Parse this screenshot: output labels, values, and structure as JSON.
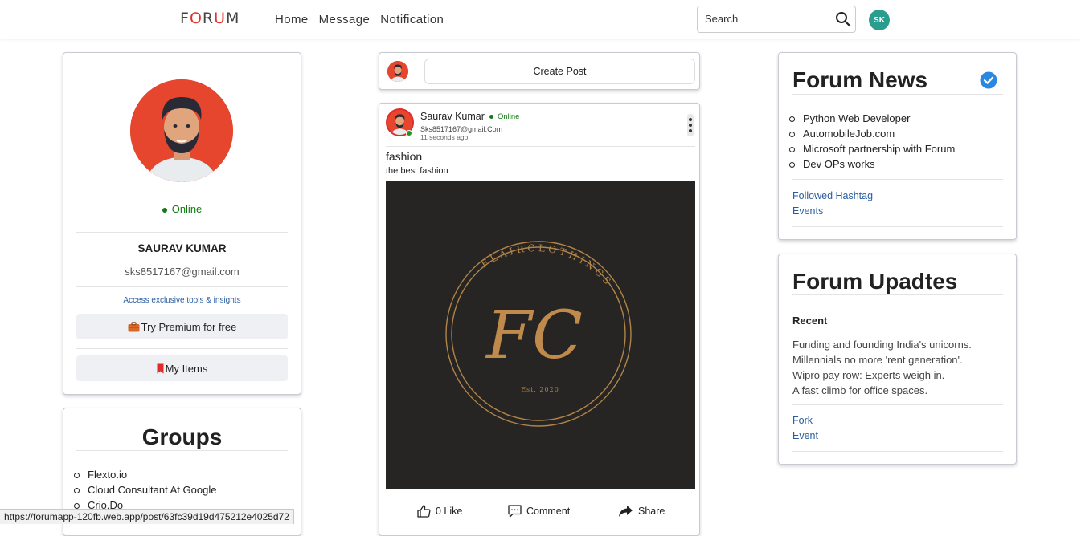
{
  "header": {
    "logo_f": "F",
    "logo_o": "O",
    "logo_r": "R",
    "logo_u": "U",
    "logo_m": "M",
    "nav": [
      "Home",
      "Message",
      "Notification"
    ],
    "search_placeholder": "Search",
    "user_initials": "SK",
    "search_icon": "search-icon",
    "accent_color": "#2a9d8f"
  },
  "profile": {
    "status": "Online",
    "name": "SAURAV KUMAR",
    "email": "sks8517167@gmail.com",
    "access_text": "Access exclusive tools & insights",
    "premium_label": "Try Premium for free",
    "my_items_label": "My Items"
  },
  "groups": {
    "title": "Groups",
    "items": [
      "Flexto.io",
      "Cloud Consultant At Google",
      "Crio.Do"
    ]
  },
  "create_post": {
    "label": "Create Post"
  },
  "post": {
    "author": "Saurav Kumar",
    "status": "Online",
    "email": "Sks8517167@gmail.Com",
    "time": "11 seconds ago",
    "title": "fashion",
    "description": "the best fashion",
    "image": {
      "brand_text": "FLAIRCLOTHINGS",
      "monogram": "FC",
      "est": "Est. 2020"
    },
    "like_label": "0 Like",
    "comment_label": "Comment",
    "share_label": "Share"
  },
  "news": {
    "title": "Forum News",
    "items": [
      "Python Web Developer",
      "AutomobileJob.com",
      "Microsoft partnership with Forum",
      "Dev OPs works"
    ],
    "links": [
      "Followed Hashtag",
      "Events"
    ]
  },
  "updates": {
    "title": "Forum Upadtes",
    "recent_label": "Recent",
    "lines": [
      "Funding and founding India's unicorns.",
      "Millennials no more 'rent generation'.",
      "Wipro pay row: Experts weigh in.",
      "A fast climb for office spaces."
    ],
    "links": [
      "Fork",
      "Event"
    ]
  },
  "status_bar": {
    "url": "https://forumapp-120fb.web.app/post/63fc39d19d475212e4025d72"
  }
}
